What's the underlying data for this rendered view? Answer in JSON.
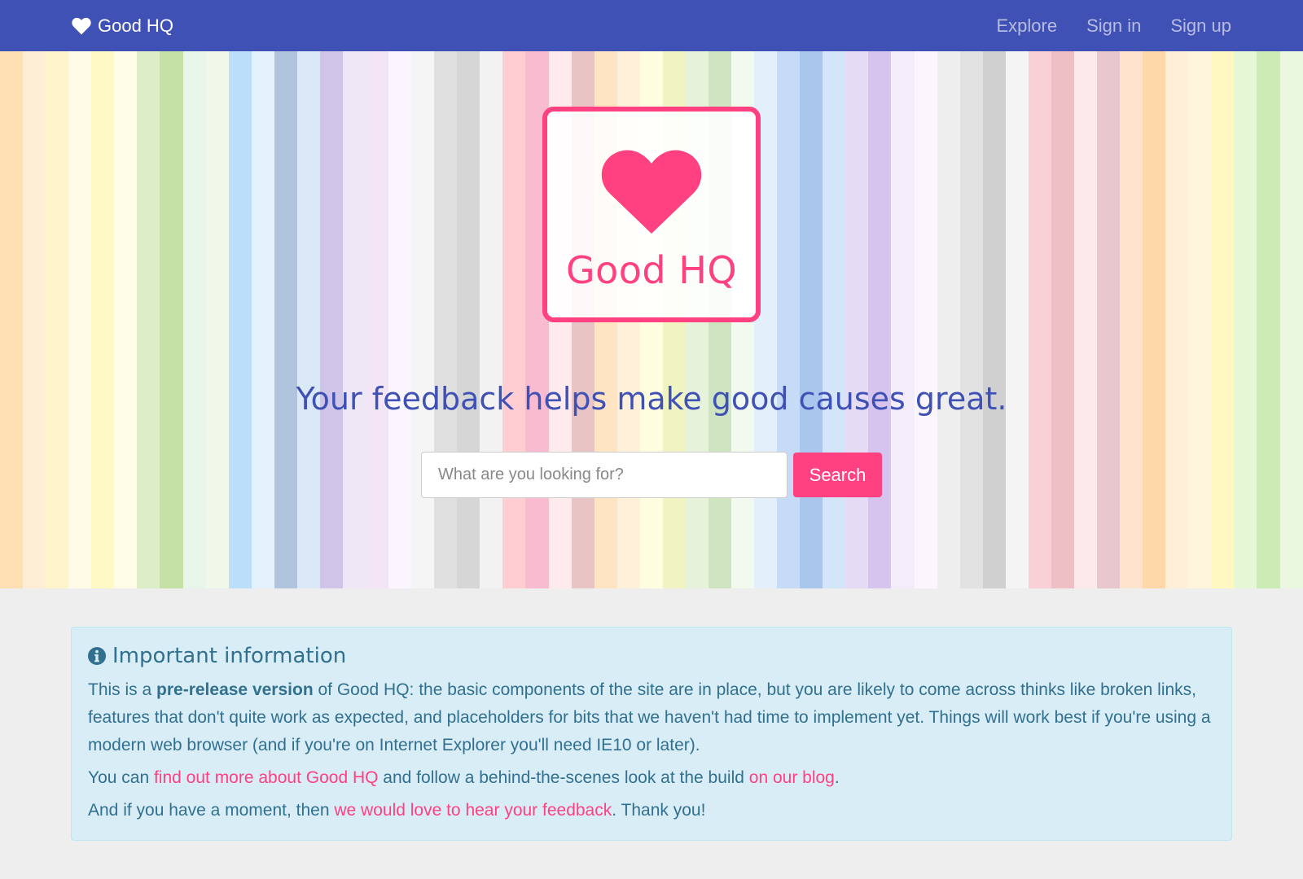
{
  "nav": {
    "brand": "Good HQ",
    "links": [
      "Explore",
      "Sign in",
      "Sign up"
    ]
  },
  "hero": {
    "logo_text": "Good HQ",
    "tagline": "Your feedback helps make good causes great.",
    "search_placeholder": "What are you looking for?",
    "search_button": "Search"
  },
  "info": {
    "heading": "Important information",
    "p1_prefix": "This is a ",
    "p1_strong": "pre-release version",
    "p1_suffix": " of Good HQ: the basic components of the site are in place, but you are likely to come across thinks like broken links, features that don't quite work as expected, and placeholders for bits that we haven't had time to implement yet. Things will work best if you're using a modern web browser (and if you're on Internet Explorer you'll need IE10 or later).",
    "p2_prefix": "You can ",
    "p2_link1": "find out more about Good HQ",
    "p2_middle": " and follow a behind-the-scenes look at the build ",
    "p2_link2": "on our blog",
    "p2_suffix": ".",
    "p3_prefix": "And if you have a moment, then ",
    "p3_link": "we would love to hear your feedback",
    "p3_suffix": ". Thank you!"
  },
  "colors": {
    "nav_bg": "#3f51b5",
    "accent": "#ff4081",
    "info_bg": "#d9edf7",
    "info_text": "#31708f",
    "stripes": [
      "#ffe0b2",
      "#ffedd5",
      "#fff4cc",
      "#fffbe6",
      "#fff9c4",
      "#fffde7",
      "#dcedc8",
      "#c5e1a5",
      "#e8f5e9",
      "#f1f8e9",
      "#bbdefb",
      "#e3f2fd",
      "#b0c4de",
      "#dbe8f7",
      "#d1c4e9",
      "#ede7f6",
      "#f3e5f5",
      "#faf5ff",
      "#f5f5f5",
      "#e0e0e0",
      "#d6d6d6",
      "#f2f2f2",
      "#ffcdd2",
      "#f8bbd0",
      "#ffebee",
      "#e8c4c4",
      "#ffe4c4",
      "#fff0d9",
      "#fffde0",
      "#f0f4c3",
      "#e6f2d9",
      "#cfe5c1",
      "#f2faf0",
      "#e3f0fb",
      "#c6dbf5",
      "#a9c7ec",
      "#d4e4f9",
      "#e6dbf5",
      "#d6c3ee",
      "#f3ecfb",
      "#fbf6fe",
      "#eeeeee",
      "#e2e2e2",
      "#d0d0d0",
      "#f4f4f4",
      "#f8d0d6",
      "#eec0c6",
      "#fde8ea",
      "#e8c8cc",
      "#ffe3cc",
      "#ffd7a8",
      "#ffefd8",
      "#fff5dc",
      "#fff8c0",
      "#e6f7d5",
      "#cdebb4",
      "#eaf8df"
    ]
  }
}
